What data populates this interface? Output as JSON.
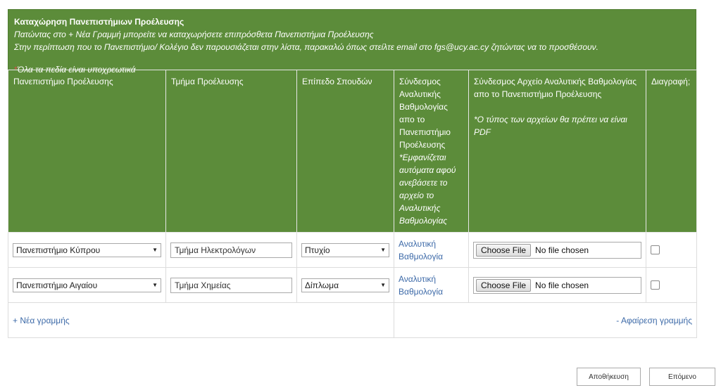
{
  "banner": {
    "title": "Καταχώρηση Πανεπιστήμιων Προέλευσης",
    "line1": "Πατώντας στο + Νέα Γραμμή μπορείτε να καταχωρήσετε επιπρόσθετα Πανεπιστήμια Προέλευσης",
    "line2": "Στην περίπτωση που το Πανεπιστήμιο/ Κολέγιο δεν παρουσιάζεται στην λίστα, παρακαλώ όπως στείλτε email στο fgs@ucy.ac.cy ζητώντας να το προσθέσουν.",
    "required_star": "*",
    "required_text": "Όλα τα πεδία είναι υποχρεωτικά"
  },
  "columns": {
    "university": "Πανεπιστήμιο Προέλευσης",
    "department": "Τμήμα Προέλευσης",
    "level": "Επίπεδο Σπουδών",
    "transcript_link_l1": "Σύνδεσμος",
    "transcript_link_l2": "Αναλυτικής",
    "transcript_link_l3": "Βαθμολογίας",
    "transcript_link_l4": "απο το",
    "transcript_link_l5": "Πανεπιστήμιο",
    "transcript_link_l6": "Προέλευσης",
    "transcript_link_n1": "*Εμφανίζεται",
    "transcript_link_n2": "αυτόματα αφού",
    "transcript_link_n3": "ανεβάσετε το",
    "transcript_link_n4": "αρχείο το",
    "transcript_link_n5": "αρχείο",
    "transcript_link_n6": "Αναλυτικής",
    "transcript_link_n7": "Βαθμολογίας",
    "transcript_file_l1": "Σύνδεσμος Αρχείο Αναλυτικής Βαθμολογίας",
    "transcript_file_l2": "απο το Πανεπιστήμιο Προέλευσης",
    "transcript_file_n1": "*Ο τύπος των αρχείων θα πρέπει να είναι",
    "transcript_file_n2": "PDF",
    "delete": "Διαγραφή;"
  },
  "rows": [
    {
      "university": "Πανεπιστήμιο Κύπρου",
      "department": "Τμήμα Ηλεκτρολόγων",
      "level": "Πτυχίο",
      "link_l1": "Αναλυτική",
      "link_l2": "Βαθμολογία",
      "file_button": "Choose File",
      "file_status": "No file chosen",
      "delete_checked": false
    },
    {
      "university": "Πανεπιστήμιο Αιγαίου",
      "department": "Τμήμα Χημείας",
      "level": "Δίπλωμα",
      "link_l1": "Αναλυτική",
      "link_l2": "Βαθμολογία",
      "file_button": "Choose File",
      "file_status": "No file chosen",
      "delete_checked": false
    }
  ],
  "footer": {
    "add_row": "+ Νέα γραμμής",
    "remove_row": "- Αφαίρεση γραμμής"
  },
  "actions": {
    "save": "Αποθήκευση",
    "next": "Επόμενο"
  },
  "colors": {
    "header_green": "#5c8c3a",
    "link_blue": "#3d6aa8",
    "required_red": "#d9534f"
  }
}
